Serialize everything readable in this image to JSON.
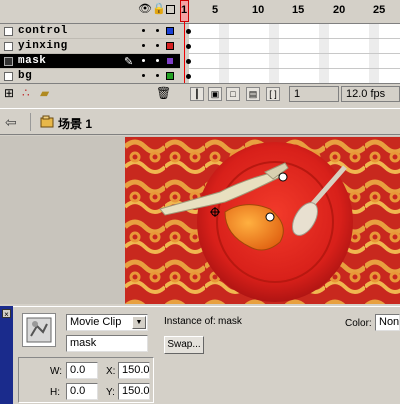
{
  "timeline": {
    "frame_numbers": [
      "1",
      "5",
      "10",
      "15",
      "20",
      "25"
    ],
    "layers": [
      {
        "name": "control",
        "color": "#1a3fd4",
        "selected": false
      },
      {
        "name": "yinxing",
        "color": "#d42020",
        "selected": false
      },
      {
        "name": "mask",
        "color": "#7f3fc8",
        "selected": true
      },
      {
        "name": "bg",
        "color": "#23a023",
        "selected": false
      }
    ],
    "current_frame": "1",
    "frame_rate": "12.0 fps"
  },
  "scene": {
    "label": "场景 1"
  },
  "properties": {
    "symbol_type": "Movie Clip",
    "instance_name": "mask",
    "instance_of_label": "Instance of:",
    "instance_of_value": "mask",
    "swap_label": "Swap...",
    "color_label": "Color:",
    "color_value": "None",
    "w_label": "W:",
    "w_value": "0.0",
    "h_label": "H:",
    "h_value": "0.0",
    "x_label": "X:",
    "x_value": "150.0",
    "y_label": "Y:",
    "y_value": "150.0"
  },
  "icons": [
    "eye-icon",
    "lock-icon",
    "outline-icon",
    "pencil-icon",
    "add-layer-icon",
    "add-guide-icon",
    "add-folder-icon",
    "trash-icon",
    "back-arrow-icon",
    "scene-icon",
    "symbol-icon",
    "dropdown-arrow-icon"
  ]
}
